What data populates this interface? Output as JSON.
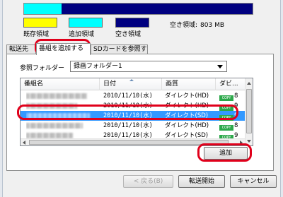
{
  "capacity": {
    "colors": {
      "existing": "#ffff00",
      "added": "#00ffff",
      "free": "#000080"
    },
    "legend": [
      {
        "label": "既存領域",
        "color": "#ffff00"
      },
      {
        "label": "追加領域",
        "color": "#00ffff"
      },
      {
        "label": "空き領域",
        "color": "#000080"
      }
    ],
    "free_space_label": "空き領域:",
    "free_space_value": "803 MB"
  },
  "tabs": [
    {
      "label": "転送先"
    },
    {
      "label": "番組を追加する",
      "active": true
    },
    {
      "label": "SDカードを参照する"
    }
  ],
  "folder": {
    "label": "参照フォルダー",
    "selected": "録画フォルダー1"
  },
  "list": {
    "columns": [
      "番組名",
      "日付",
      "画質",
      "ダビ..."
    ],
    "rows": [
      {
        "date": "2010/11/10(水)",
        "quality": "ダイレクト(HD)",
        "dub": "8",
        "selected": false
      },
      {
        "date": "2010/11/10(水)",
        "quality": "ダイレクト(HD)",
        "dub": "9",
        "selected": false
      },
      {
        "date": "2010/11/10(水)",
        "quality": "ダイレクト(SD)",
        "dub": "9",
        "selected": true
      },
      {
        "date": "2010/11/10(水)",
        "quality": "ダイレクト(HD)",
        "dub": "8",
        "selected": false
      },
      {
        "date": "2010/11/10(水)",
        "quality": "ダイレクト(SD)",
        "dub": "9",
        "selected": false
      }
    ],
    "copy_badge": "COPY"
  },
  "buttons": {
    "add": "追加",
    "back": "< 戻る(B)",
    "start": "転送開始",
    "cancel": "キャンセル"
  },
  "highlight_color": "#e0001b"
}
